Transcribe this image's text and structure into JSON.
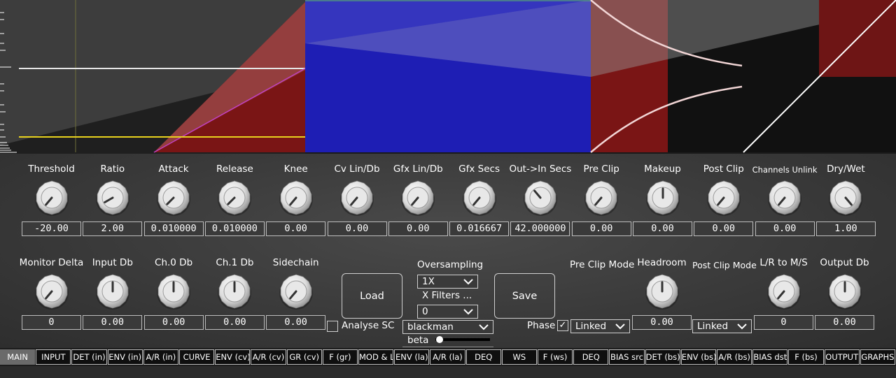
{
  "colors": {
    "graph_bg": "#1a1a1a",
    "red_region": "#7a1515",
    "blue_region": "#1e1eb4",
    "yellow_line": "#e8d21e",
    "panel_bg": "#3c3c3c",
    "active_tab": "#6a6a6a",
    "tab_bg": "#0f0f0f"
  },
  "row1": [
    {
      "label": "Threshold",
      "value": "-20.00",
      "angle": -140,
      "name": "threshold"
    },
    {
      "label": "Ratio",
      "value": "2.00",
      "angle": -120,
      "name": "ratio"
    },
    {
      "label": "Attack",
      "value": "0.010000",
      "angle": -135,
      "name": "attack"
    },
    {
      "label": "Release",
      "value": "0.010000",
      "angle": -135,
      "name": "release"
    },
    {
      "label": "Knee",
      "value": "0.00",
      "angle": -140,
      "name": "knee"
    },
    {
      "label": "Cv Lin/Db",
      "value": "0.00",
      "angle": -140,
      "name": "cv-lin-db"
    },
    {
      "label": "Gfx Lin/Db",
      "value": "0.00",
      "angle": -140,
      "name": "gfx-lin-db"
    },
    {
      "label": "Gfx Secs",
      "value": "0.016667",
      "angle": -140,
      "name": "gfx-secs"
    },
    {
      "label": "Out->In Secs",
      "value": "42.000000",
      "angle": -40,
      "name": "out-in-secs"
    },
    {
      "label": "Pre Clip",
      "value": "0.00",
      "angle": -140,
      "name": "pre-clip"
    },
    {
      "label": "Makeup",
      "value": "0.00",
      "angle": 0,
      "name": "makeup"
    },
    {
      "label": "Post Clip",
      "value": "0.00",
      "angle": -140,
      "name": "post-clip"
    },
    {
      "label": "Channels Unlink",
      "value": "0.00",
      "angle": -140,
      "name": "channels-unlink",
      "small": true
    },
    {
      "label": "Dry/Wet",
      "value": "1.00",
      "angle": 140,
      "name": "dry-wet"
    }
  ],
  "row2_left": [
    {
      "label": "Monitor Delta",
      "value": "0",
      "angle": -140,
      "name": "monitor-delta"
    },
    {
      "label": "Input Db",
      "value": "0.00",
      "angle": 0,
      "name": "input-db"
    },
    {
      "label": "Ch.0 Db",
      "value": "0.00",
      "angle": 0,
      "name": "ch0-db"
    },
    {
      "label": "Ch.1 Db",
      "value": "0.00",
      "angle": 0,
      "name": "ch1-db"
    },
    {
      "label": "Sidechain",
      "value": "0.00",
      "angle": -140,
      "name": "sidechain"
    }
  ],
  "row2_right": [
    {
      "label": "Headroom",
      "value": "0.00",
      "angle": 0,
      "name": "headroom"
    },
    {
      "label": "L/R to M/S",
      "value": "0",
      "angle": -140,
      "name": "lr-to-ms"
    },
    {
      "label": "Output Db",
      "value": "0.00",
      "angle": 0,
      "name": "output-db"
    }
  ],
  "controls": {
    "load_label": "Load",
    "save_label": "Save",
    "oversampling_label": "Oversampling",
    "oversampling_value": "1X",
    "xfilters_label": "X Filters ...",
    "xfilters_value": "0",
    "analyse_sc_label": "Analyse SC",
    "window_value": "blackman",
    "beta_label": "beta",
    "beta_value": 0.03,
    "pre_clip_mode_label": "Pre Clip Mode",
    "pre_clip_mode_value": "Linked",
    "post_clip_mode_label": "Post Clip Mode",
    "post_clip_mode_value": "Linked",
    "phase_label": "Phase",
    "phase_checked": true,
    "check_glyph": "✓"
  },
  "tabs": [
    "MAIN",
    "INPUT",
    "DET (in)",
    "ENV (in)",
    "A/R (in)",
    "CURVE",
    "ENV (cv)",
    "A/R (cv)",
    "GR (cv)",
    "F (gr)",
    "MOD & LA",
    "ENV (la)",
    "A/R (la)",
    "DEQ",
    "WS",
    "F (ws)",
    "DEQ",
    "BIAS src",
    "DET (bs)",
    "ENV (bs)",
    "A/R (bs)",
    "BIAS dst",
    "F (bs)",
    "OUTPUT",
    "GRAPHS"
  ],
  "active_tab": 0
}
